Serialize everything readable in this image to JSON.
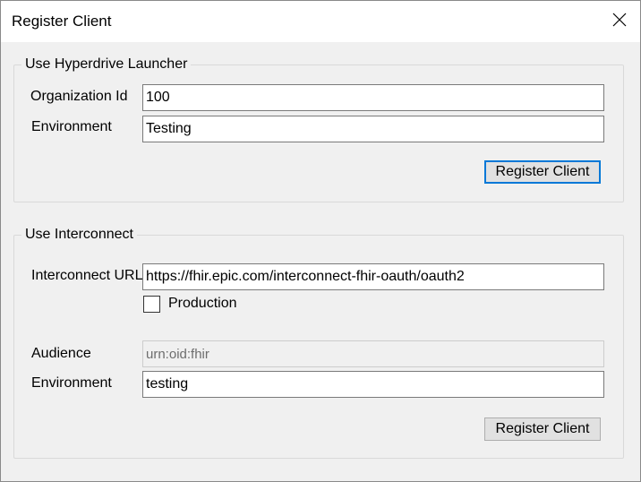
{
  "window": {
    "title": "Register Client",
    "close_icon": "close-icon"
  },
  "hyperdrive": {
    "legend": "Use Hyperdrive Launcher",
    "org_label": "Organization Id",
    "org_value": "100",
    "env_label": "Environment",
    "env_value": "Testing",
    "register_label": "Register Client"
  },
  "interconnect": {
    "legend": "Use Interconnect",
    "url_label": "Interconnect URL",
    "url_value": "https://fhir.epic.com/interconnect-fhir-oauth/oauth2",
    "production_label": "Production",
    "production_checked": false,
    "audience_label": "Audience",
    "audience_value": "urn:oid:fhir",
    "env_label": "Environment",
    "env_value": "testing",
    "register_label": "Register Client"
  }
}
